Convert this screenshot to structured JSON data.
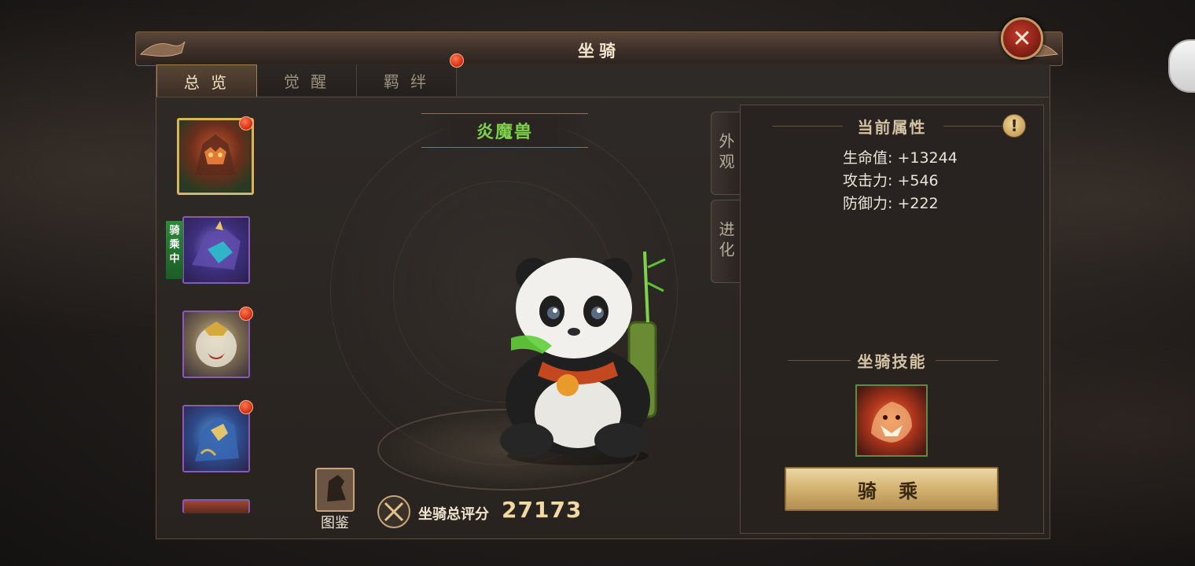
{
  "window": {
    "title": "坐骑",
    "close_icon": "close-icon"
  },
  "tabs": [
    {
      "label": "总 览",
      "active": true
    },
    {
      "label": "觉 醒",
      "active": false
    },
    {
      "label": "羁 绊",
      "active": false,
      "has_dot": true
    }
  ],
  "mounts": [
    {
      "name": "mount-1",
      "selected": true,
      "has_dot": true,
      "riding": false
    },
    {
      "name": "mount-2",
      "selected": false,
      "has_dot": false,
      "riding": true
    },
    {
      "name": "mount-3",
      "selected": false,
      "has_dot": true,
      "riding": false
    },
    {
      "name": "mount-4",
      "selected": false,
      "has_dot": true,
      "riding": false
    },
    {
      "name": "mount-5",
      "selected": false,
      "has_dot": false,
      "riding": false
    }
  ],
  "riding_tag": "骑乘中",
  "current_mount_name": "炎魔兽",
  "side_tabs": {
    "appearance": "外观",
    "evolve": "进化"
  },
  "attributes": {
    "title": "当前属性",
    "stats": [
      "生命值: +13244",
      "攻击力: +546",
      "防御力: +222"
    ]
  },
  "skills": {
    "title": "坐骑技能"
  },
  "ride_button": "骑 乘",
  "codex_label": "图鉴",
  "score": {
    "label": "坐骑总评分",
    "value": "27173"
  },
  "colors": {
    "accent_gold": "#d8b45e",
    "name_green": "#7ed34a",
    "alert_red": "#d32a10"
  }
}
